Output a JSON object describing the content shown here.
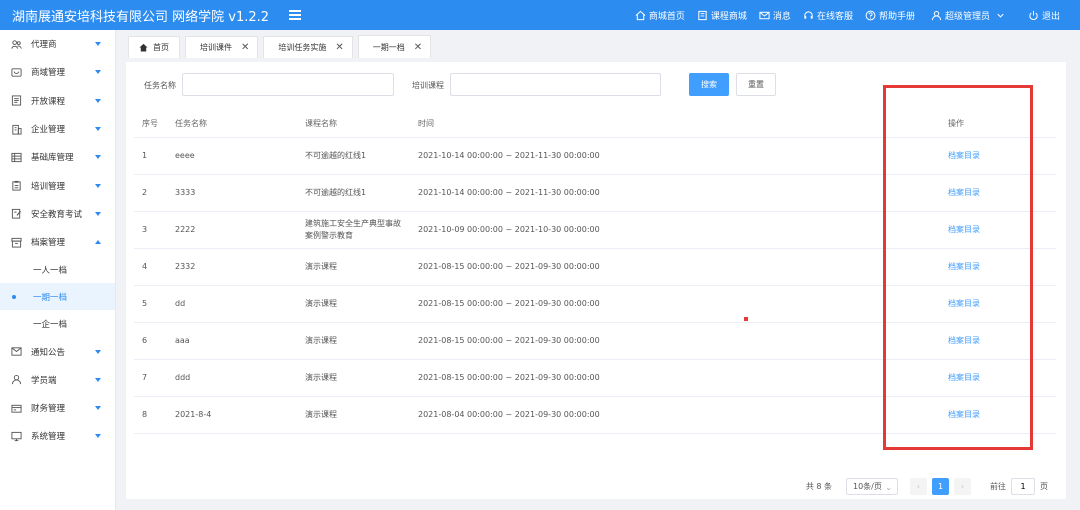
{
  "app": {
    "title": "湖南展通安培科技有限公司 网络学院 v1.2.2"
  },
  "topnav": [
    {
      "label": "商城首页",
      "icon": "home-icon"
    },
    {
      "label": "课程商城",
      "icon": "book-icon"
    },
    {
      "label": "消息",
      "icon": "mail-icon"
    },
    {
      "label": "在线客服",
      "icon": "headset-icon"
    },
    {
      "label": "帮助手册",
      "icon": "help-icon"
    }
  ],
  "user": {
    "label": "超级管理员",
    "icon": "user-icon"
  },
  "logout": {
    "label": "退出",
    "icon": "power-icon"
  },
  "sidebar": {
    "items": [
      {
        "label": "代理商",
        "icon": "agent-icon"
      },
      {
        "label": "商域管理",
        "icon": "store-icon"
      },
      {
        "label": "开放课程",
        "icon": "course-icon"
      },
      {
        "label": "企业管理",
        "icon": "building-icon"
      },
      {
        "label": "基础库管理",
        "icon": "database-icon"
      },
      {
        "label": "培训管理",
        "icon": "training-icon"
      },
      {
        "label": "安全教育考试",
        "icon": "exam-icon"
      },
      {
        "label": "档案管理",
        "icon": "archive-icon",
        "expanded": true
      }
    ],
    "sub": [
      "一人一档",
      "一期一档",
      "一企一档"
    ],
    "sub_active_index": 1,
    "items_after": [
      {
        "label": "通知公告",
        "icon": "notice-icon"
      },
      {
        "label": "学员端",
        "icon": "student-icon"
      },
      {
        "label": "财务管理",
        "icon": "finance-icon"
      },
      {
        "label": "系统管理",
        "icon": "system-icon"
      }
    ]
  },
  "tabs": [
    {
      "label": "首页",
      "closable": false
    },
    {
      "label": "培训课件",
      "closable": true
    },
    {
      "label": "培训任务实施",
      "closable": true
    },
    {
      "label": "一期一档",
      "closable": true,
      "active": true
    }
  ],
  "filters": {
    "task_name_label": "任务名称",
    "task_name_value": "",
    "course_label": "培训课程",
    "course_value": "",
    "search_label": "搜索",
    "reset_label": "重置"
  },
  "table": {
    "headers": [
      "序号",
      "任务名称",
      "课程名称",
      "时间",
      "操作"
    ],
    "rows": [
      {
        "no": "1",
        "task": "eeee",
        "course": "不可逾越的红线1",
        "time": "2021-10-14 00:00:00 ~ 2021-11-30 00:00:00",
        "action": "档案目录"
      },
      {
        "no": "2",
        "task": "3333",
        "course": "不可逾越的红线1",
        "time": "2021-10-14 00:00:00 ~ 2021-11-30 00:00:00",
        "action": "档案目录"
      },
      {
        "no": "3",
        "task": "2222",
        "course": "建筑施工安全生产典型事故案例警示教育",
        "time": "2021-10-09 00:00:00 ~ 2021-10-30 00:00:00",
        "action": "档案目录"
      },
      {
        "no": "4",
        "task": "2332",
        "course": "演示课程",
        "time": "2021-08-15 00:00:00 ~ 2021-09-30 00:00:00",
        "action": "档案目录"
      },
      {
        "no": "5",
        "task": "dd",
        "course": "演示课程",
        "time": "2021-08-15 00:00:00 ~ 2021-09-30 00:00:00",
        "action": "档案目录"
      },
      {
        "no": "6",
        "task": "aaa",
        "course": "演示课程",
        "time": "2021-08-15 00:00:00 ~ 2021-09-30 00:00:00",
        "action": "档案目录"
      },
      {
        "no": "7",
        "task": "ddd",
        "course": "演示课程",
        "time": "2021-08-15 00:00:00 ~ 2021-09-30 00:00:00",
        "action": "档案目录"
      },
      {
        "no": "8",
        "task": "2021-8-4",
        "course": "演示课程",
        "time": "2021-08-04 00:00:00 ~ 2021-09-30 00:00:00",
        "action": "档案目录"
      }
    ]
  },
  "pagination": {
    "total": "共 8 条",
    "page_size": "10条/页",
    "current_page": "1",
    "goto_label": "前往",
    "goto_value": "1",
    "page_suffix": "页"
  },
  "colors": {
    "primary": "#2d8cf0",
    "link": "#409eff",
    "highlight": "#e53935"
  }
}
